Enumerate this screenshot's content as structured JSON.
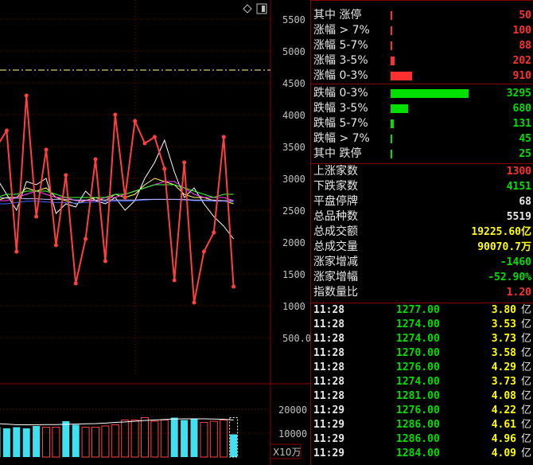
{
  "stats_top": [
    {
      "label": "其中 涨停",
      "value": "50",
      "color": "#ff3030",
      "bar_fraction": 0.012
    },
    {
      "label": "涨幅 > 7%",
      "value": "100",
      "color": "#ff3030",
      "bar_fraction": 0.024
    },
    {
      "label": "涨幅 5-7%",
      "value": "88",
      "color": "#ff3030",
      "bar_fraction": 0.021
    },
    {
      "label": "涨幅 3-5%",
      "value": "202",
      "color": "#ff3030",
      "bar_fraction": 0.05
    },
    {
      "label": "涨幅 0-3%",
      "value": "910",
      "color": "#ff3030",
      "bar_fraction": 0.28
    }
  ],
  "stats_mid": [
    {
      "label": "跌幅 0-3%",
      "value": "3295",
      "color": "#00e000",
      "bar_fraction": 1.0
    },
    {
      "label": "跌幅 3-5%",
      "value": "680",
      "color": "#00e000",
      "bar_fraction": 0.22
    },
    {
      "label": "跌幅 5-7%",
      "value": "131",
      "color": "#00e000",
      "bar_fraction": 0.045
    },
    {
      "label": "跌幅 > 7%",
      "value": "45",
      "color": "#00e000",
      "bar_fraction": 0.015
    },
    {
      "label": "其中 跌停",
      "value": "25",
      "color": "#00e000",
      "bar_fraction": 0.01
    }
  ],
  "stats_bottom": [
    {
      "label": "上涨家数",
      "value": "1300",
      "color": "#ff3030"
    },
    {
      "label": "下跌家数",
      "value": "4151",
      "color": "#00e000"
    },
    {
      "label": "平盘停牌",
      "value": "68",
      "color": "#e8e8e8"
    },
    {
      "label": "总品种数",
      "value": "5519",
      "color": "#e8e8e8"
    },
    {
      "label": "总成交额",
      "value": "19225.60亿",
      "color": "#ffff00"
    },
    {
      "label": "总成交量",
      "value": "90070.7万",
      "color": "#ffff00"
    },
    {
      "label": "涨家增减",
      "value": "-1460",
      "color": "#00e000"
    },
    {
      "label": "涨家增幅",
      "value": "-52.90%",
      "color": "#00e000"
    },
    {
      "label": "指数量比",
      "value": "1.20",
      "color": "#ff3030"
    }
  ],
  "trades": [
    {
      "time": "11:28",
      "price": "1277.00",
      "amount": "3.80",
      "unit": "亿"
    },
    {
      "time": "11:28",
      "price": "1274.00",
      "amount": "3.53",
      "unit": "亿"
    },
    {
      "time": "11:28",
      "price": "1274.00",
      "amount": "3.73",
      "unit": "亿"
    },
    {
      "time": "11:28",
      "price": "1270.00",
      "amount": "3.58",
      "unit": "亿"
    },
    {
      "time": "11:28",
      "price": "1276.00",
      "amount": "4.29",
      "unit": "亿"
    },
    {
      "time": "11:28",
      "price": "1274.00",
      "amount": "3.73",
      "unit": "亿"
    },
    {
      "time": "11:28",
      "price": "1281.00",
      "amount": "4.08",
      "unit": "亿"
    },
    {
      "time": "11:29",
      "price": "1276.00",
      "amount": "4.22",
      "unit": "亿"
    },
    {
      "time": "11:29",
      "price": "1286.00",
      "amount": "4.61",
      "unit": "亿"
    },
    {
      "time": "11:29",
      "price": "1286.00",
      "amount": "4.96",
      "unit": "亿"
    },
    {
      "time": "11:29",
      "price": "1284.00",
      "amount": "4.09",
      "unit": "亿"
    }
  ],
  "price_axis": [
    "5500",
    "5000",
    "4500",
    "4000",
    "3500",
    "3000",
    "2500",
    "2000",
    "1500",
    "1000",
    "500.0"
  ],
  "volume_axis": [
    "20000",
    "10000"
  ],
  "volume_unit": "X10万",
  "reference_level": 4700,
  "main_series": [
    3500,
    3750,
    1850,
    4300,
    2400,
    3450,
    1950,
    3050,
    1350,
    2050,
    3300,
    1700,
    4000,
    2700,
    3900,
    3550,
    3650,
    3150,
    1400,
    3250,
    1050,
    1850,
    2150,
    3650,
    1300
  ],
  "ma_series": [
    {
      "color": "#ffffff",
      "values": [
        3000,
        2750,
        2500,
        2950,
        2900,
        3000,
        2450,
        2600,
        2550,
        2800,
        2650,
        2600,
        2700,
        2500,
        2650,
        3000,
        3250,
        3600,
        3100,
        2700,
        2850,
        2600,
        2400,
        2250,
        2050
      ]
    },
    {
      "color": "#ffff66",
      "values": [
        2650,
        2700,
        2700,
        2850,
        2800,
        2850,
        2700,
        2650,
        2600,
        2650,
        2700,
        2650,
        2750,
        2700,
        2750,
        2900,
        3000,
        2950,
        2900,
        2750,
        2700,
        2700,
        2650,
        2650,
        2600
      ]
    },
    {
      "color": "#ff40ff",
      "values": [
        2650,
        2650,
        2700,
        2750,
        2800,
        2750,
        2700,
        2700,
        2650,
        2650,
        2650,
        2700,
        2700,
        2750,
        2800,
        2850,
        2900,
        2950,
        2950,
        2850,
        2750,
        2700,
        2700,
        2700,
        2650
      ]
    },
    {
      "color": "#40ff40",
      "values": [
        2700,
        2750,
        2750,
        2800,
        2800,
        2800,
        2750,
        2700,
        2700,
        2700,
        2700,
        2700,
        2750,
        2750,
        2800,
        2850,
        2900,
        2900,
        2900,
        2850,
        2800,
        2750,
        2700,
        2750,
        2750
      ]
    },
    {
      "color": "#4060ff",
      "values": [
        2600,
        2600,
        2620,
        2640,
        2640,
        2630,
        2620,
        2620,
        2610,
        2620,
        2630,
        2630,
        2640,
        2640,
        2650,
        2660,
        2670,
        2670,
        2670,
        2660,
        2650,
        2650,
        2640,
        2640,
        2630
      ]
    },
    {
      "color": "#c0c0ff",
      "values": [
        2700,
        2690,
        2690,
        2680,
        2680,
        2670,
        2670,
        2670,
        2660,
        2660,
        2660,
        2660,
        2660,
        2660,
        2660,
        2670,
        2670,
        2670,
        2670,
        2670,
        2660,
        2660,
        2660,
        2650,
        2650
      ]
    }
  ],
  "volume_bars": [
    {
      "value": 12500,
      "filled": true
    },
    {
      "value": 12000,
      "filled": true
    },
    {
      "value": 12500,
      "filled": true
    },
    {
      "value": 12000,
      "filled": true
    },
    {
      "value": 13000,
      "filled": true
    },
    {
      "value": 12500,
      "filled": false
    },
    {
      "value": 12500,
      "filled": false
    },
    {
      "value": 15000,
      "filled": true
    },
    {
      "value": 13500,
      "filled": true
    },
    {
      "value": 12500,
      "filled": false
    },
    {
      "value": 12500,
      "filled": false
    },
    {
      "value": 13000,
      "filled": false
    },
    {
      "value": 13500,
      "filled": false
    },
    {
      "value": 15500,
      "filled": false
    },
    {
      "value": 15500,
      "filled": false
    },
    {
      "value": 16500,
      "filled": false
    },
    {
      "value": 15000,
      "filled": false
    },
    {
      "value": 15500,
      "filled": false
    },
    {
      "value": 16500,
      "filled": true
    },
    {
      "value": 15500,
      "filled": true
    },
    {
      "value": 16000,
      "filled": true
    },
    {
      "value": 14500,
      "filled": false
    },
    {
      "value": 15000,
      "filled": false
    },
    {
      "value": 15500,
      "filled": false
    },
    {
      "value": 9500,
      "filled": true
    }
  ],
  "volume_ma": [
    14000,
    13800,
    13500,
    13500,
    13500,
    13600,
    13600,
    13700,
    13800,
    13900,
    14000,
    14200,
    14500,
    14700,
    15000,
    15300,
    15500,
    15700,
    15900,
    16000,
    16000,
    16000,
    15900,
    15800,
    15500
  ]
}
